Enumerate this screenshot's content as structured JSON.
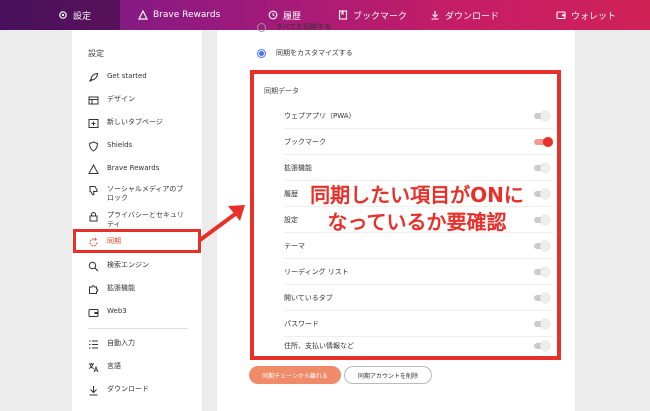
{
  "nav": {
    "tabs": [
      {
        "label": "設定",
        "icon": "gear-icon",
        "active": true
      },
      {
        "label": "Brave Rewards",
        "icon": "triangle-icon",
        "active": false
      },
      {
        "label": "履歴",
        "icon": "history-icon",
        "active": false
      },
      {
        "label": "ブックマーク",
        "icon": "bookmark-icon",
        "active": false
      },
      {
        "label": "ダウンロード",
        "icon": "download-icon",
        "active": false
      },
      {
        "label": "ウォレット",
        "icon": "wallet-icon",
        "active": false
      }
    ]
  },
  "sidebar": {
    "heading": "設定",
    "items": [
      {
        "label": "Get started",
        "icon": "rocket-icon"
      },
      {
        "label": "デザイン",
        "icon": "design-icon"
      },
      {
        "label": "新しいタブページ",
        "icon": "new-tab-icon"
      },
      {
        "label": "Shields",
        "icon": "shield-icon"
      },
      {
        "label": "Brave Rewards",
        "icon": "triangle-icon"
      },
      {
        "label": "ソーシャルメディアのブロック",
        "icon": "thumbs-down-icon"
      },
      {
        "label": "プライバシーとセキュリティ",
        "icon": "lock-icon"
      },
      {
        "label": "同期",
        "icon": "sync-icon",
        "active": true
      },
      {
        "label": "検索エンジン",
        "icon": "search-icon"
      },
      {
        "label": "拡張機能",
        "icon": "puzzle-icon"
      },
      {
        "label": "Web3",
        "icon": "wallet-icon"
      },
      {
        "label": "自動入力",
        "icon": "list-icon"
      },
      {
        "label": "言語",
        "icon": "translate-icon"
      },
      {
        "label": "ダウンロード",
        "icon": "download-icon"
      }
    ]
  },
  "main": {
    "options": [
      {
        "label": "すべてを同期する",
        "selected": false
      },
      {
        "label": "同期をカスタマイズする",
        "selected": true
      }
    ],
    "sync_title": "同期データ",
    "sync_items": [
      {
        "label": "ウェブアプリ（PWA）",
        "on": false
      },
      {
        "label": "ブックマーク",
        "on": true
      },
      {
        "label": "拡張機能",
        "on": false
      },
      {
        "label": "履歴",
        "on": false
      },
      {
        "label": "設定",
        "on": false
      },
      {
        "label": "テーマ",
        "on": false
      },
      {
        "label": "リーディング リスト",
        "on": false
      },
      {
        "label": "開いているタブ",
        "on": false
      },
      {
        "label": "パスワード",
        "on": false
      },
      {
        "label": "住所、支払い情報など",
        "on": false
      }
    ],
    "buttons": {
      "leave": "同期チェーンから離れる",
      "delete": "同期アカウントを削除"
    }
  },
  "annotation": {
    "line1": "同期したい項目がONに",
    "line2": "なっているか要確認"
  },
  "colors": {
    "accent": "#e8302a",
    "active_nav": "#e8462a",
    "radio": "#4a6cf7"
  }
}
